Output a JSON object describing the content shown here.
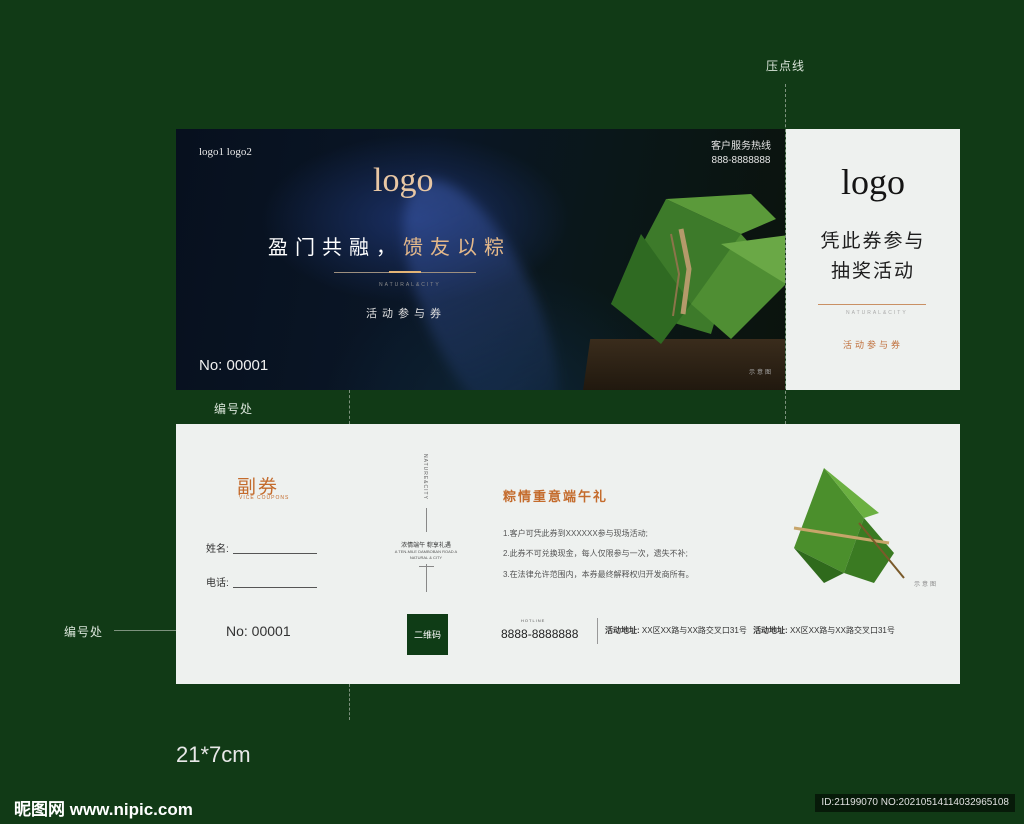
{
  "annotations": {
    "crease_line": "压点线",
    "number_position_top": "编号处",
    "number_position_left": "编号处",
    "size": "21*7cm"
  },
  "main_ticket": {
    "small_logos": "logo1  logo2",
    "hotline_label": "客户服务热线",
    "hotline_number": "888-8888888",
    "logo": "logo",
    "slogan_part1": "盈门共融，",
    "slogan_part2": "馈友以粽",
    "small_text": "NATURAL&CITY",
    "activity_label": "活动参与券",
    "number": "No:  00001",
    "image_note": "示意图"
  },
  "top_stub": {
    "logo": "logo",
    "line1": "凭此券参与",
    "line2": "抽奖活动",
    "small_text": "NATURAL&CITY",
    "activity_label": "活动参与券"
  },
  "bottom_ticket": {
    "vice_title": "副券",
    "vice_title_sub": "VICE COUPONS",
    "name_label": "姓名:",
    "phone_label": "电话:",
    "number": "No:  00001",
    "vertical_text": "NATURE&CITY",
    "caption": "浓情端午 粽享礼遇",
    "caption_small": "A TEN-MILE DAMBOBAN ROAD A NATURAL & CITY",
    "qr_label": "二维码",
    "heading": "粽情重意端午礼",
    "rules": [
      "1.客户可凭此券到XXXXXX参与现场活动;",
      "2.此券不可兑换现金，每人仅限参与一次，遗失不补;",
      "3.在法律允许范围内，本券最终解释权归开发商所有。"
    ],
    "hotline_label": "HOTLINE",
    "hotline_number": "8888-8888888",
    "address_label_1": "活动地址:",
    "address_1": "XX区XX路与XX路交叉口31号",
    "address_label_2": "活动地址:",
    "address_2": "XX区XX路与XX路交叉口31号",
    "image_note": "示意图"
  },
  "watermark": "昵图网 www.nipic.com",
  "id_bar": "ID:21199070 NO:20210514114032965108",
  "colors": {
    "background": "#113a16",
    "accent_orange": "#c46b2c",
    "gold": "#e8c7a4",
    "qr_green": "#0f3c16"
  }
}
